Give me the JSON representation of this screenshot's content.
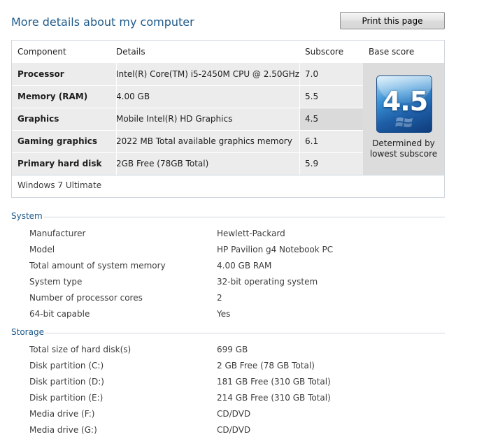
{
  "page": {
    "title": "More details about my computer",
    "print_label": "Print this page"
  },
  "score_table": {
    "headers": {
      "component": "Component",
      "details": "Details",
      "subscore": "Subscore",
      "base_score": "Base score"
    },
    "rows": [
      {
        "component": "Processor",
        "details": "Intel(R) Core(TM) i5-2450M CPU @ 2.50GHz",
        "subscore": "7.0"
      },
      {
        "component": "Memory (RAM)",
        "details": "4.00 GB",
        "subscore": "5.5"
      },
      {
        "component": "Graphics",
        "details": "Mobile Intel(R) HD Graphics",
        "subscore": "4.5"
      },
      {
        "component": "Gaming graphics",
        "details": "2022 MB Total available graphics memory",
        "subscore": "6.1"
      },
      {
        "component": "Primary hard disk",
        "details": "2GB Free (78GB Total)",
        "subscore": "5.9"
      }
    ],
    "base_score": "4.5",
    "base_score_note": "Determined by lowest subscore",
    "edition": "Windows 7 Ultimate"
  },
  "system": {
    "heading": "System",
    "items": [
      {
        "label": "Manufacturer",
        "value": "Hewlett-Packard"
      },
      {
        "label": "Model",
        "value": "HP Pavilion g4 Notebook PC"
      },
      {
        "label": "Total amount of system memory",
        "value": "4.00 GB RAM"
      },
      {
        "label": "System type",
        "value": "32-bit operating system"
      },
      {
        "label": "Number of processor cores",
        "value": "2"
      },
      {
        "label": "64-bit capable",
        "value": "Yes"
      }
    ]
  },
  "storage": {
    "heading": "Storage",
    "items": [
      {
        "label": "Total size of hard disk(s)",
        "value": "699 GB"
      },
      {
        "label": "Disk partition (C:)",
        "value": "2 GB Free (78 GB Total)"
      },
      {
        "label": "Disk partition (D:)",
        "value": "181 GB Free (310 GB Total)"
      },
      {
        "label": "Disk partition (E:)",
        "value": "214 GB Free (310 GB Total)"
      },
      {
        "label": "Media drive (F:)",
        "value": "CD/DVD"
      },
      {
        "label": "Media drive (G:)",
        "value": "CD/DVD"
      }
    ]
  },
  "colors": {
    "heading_blue": "#1e5a8a",
    "row_gray": "#ececec",
    "badge_blue": "#1e5fa8"
  },
  "icons": {
    "badge": "windows-flag-icon"
  }
}
